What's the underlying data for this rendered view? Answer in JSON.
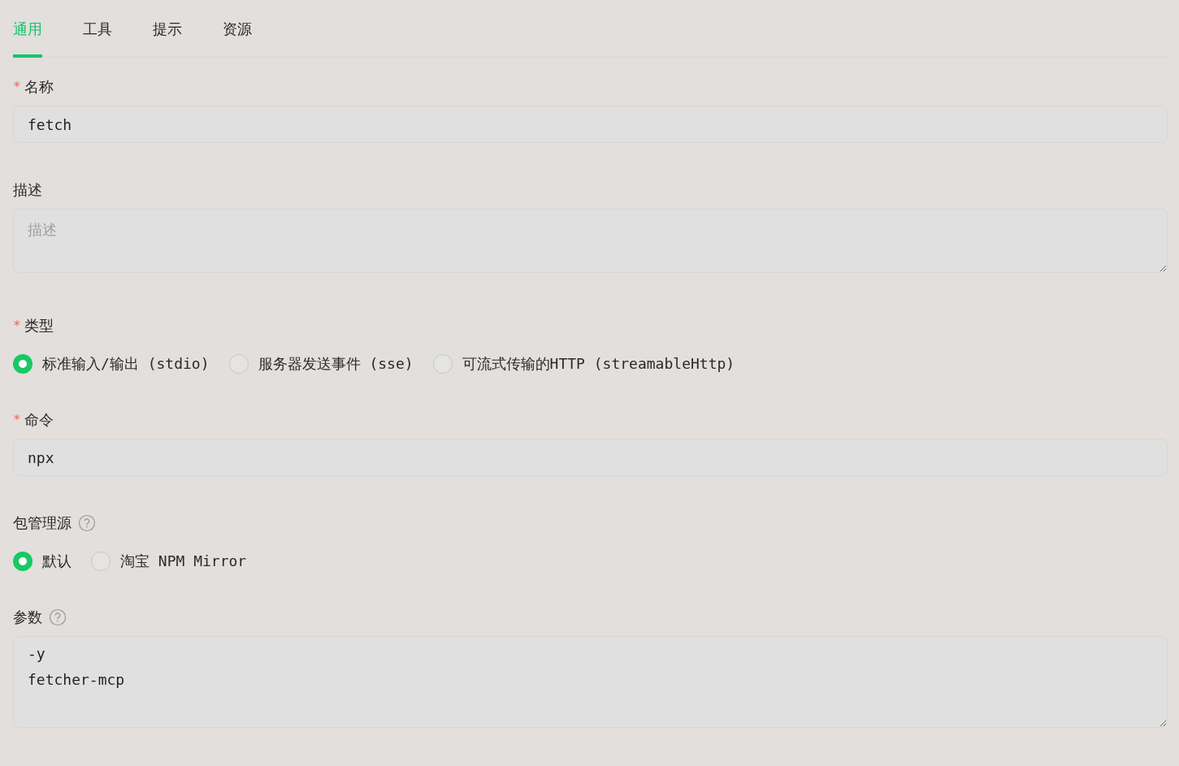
{
  "tabs": [
    {
      "label": "通用",
      "selected": true
    },
    {
      "label": "工具",
      "selected": false
    },
    {
      "label": "提示",
      "selected": false
    },
    {
      "label": "资源",
      "selected": false
    }
  ],
  "fields": [
    {
      "kind": "input",
      "marker": "*",
      "label": "名称",
      "value": "fetch"
    },
    {
      "kind": "textarea",
      "label": "描述",
      "placeholder": "描述"
    },
    {
      "kind": "radio",
      "marker": "*",
      "label": "类型",
      "options": [
        {
          "label": "标准输入/输出 (stdio)",
          "selected": true
        },
        {
          "label": "服务器发送事件 (sse)",
          "selected": false
        },
        {
          "label": "可流式传输的HTTP (streamableHttp)",
          "selected": false
        }
      ]
    },
    {
      "kind": "input",
      "marker": "*",
      "label": "命令",
      "value": "npx"
    },
    {
      "kind": "radio",
      "label": "包管理源",
      "help": true,
      "options": [
        {
          "label": "默认",
          "selected": true
        },
        {
          "label": "淘宝 NPM Mirror",
          "selected": false
        }
      ]
    },
    {
      "kind": "textarea",
      "label": "参数",
      "help": true,
      "value": "-y\nfetcher-mcp",
      "tall": true
    }
  ]
}
